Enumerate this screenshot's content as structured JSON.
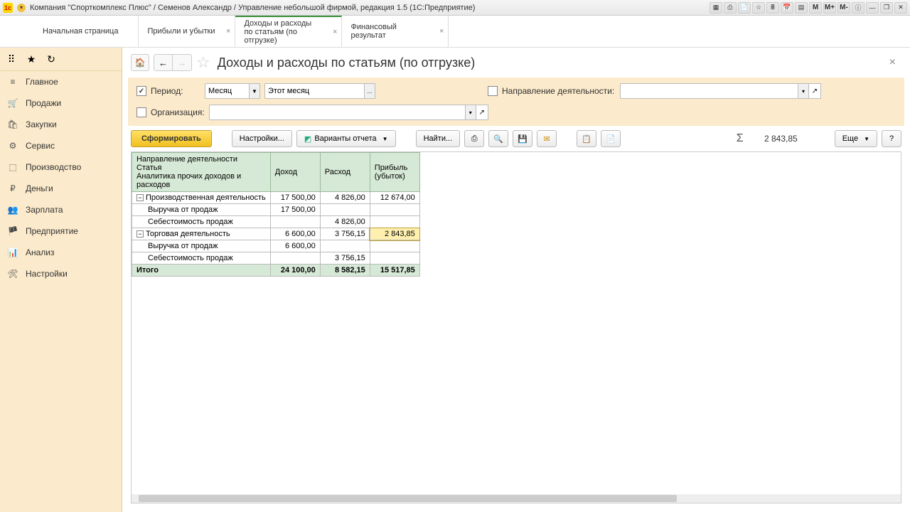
{
  "titlebar": {
    "text": "Компания \"Спорткомплекс Плюс\" / Семенов Александр / Управление небольшой фирмой, редакция 1.5  (1С:Предприятие)"
  },
  "tabs": [
    {
      "label": "Начальная страница",
      "closable": false
    },
    {
      "label": "Прибыли и убытки",
      "closable": true
    },
    {
      "label": "Доходы и расходы по статьям (по отгрузке)",
      "closable": true,
      "active": true
    },
    {
      "label": "Финансовый результат",
      "closable": true
    }
  ],
  "sidebar": {
    "items": [
      {
        "icon": "≡",
        "label": "Главное"
      },
      {
        "icon": "🛒",
        "label": "Продажи"
      },
      {
        "icon": "🛍",
        "label": "Закупки"
      },
      {
        "icon": "⚙",
        "label": "Сервис"
      },
      {
        "icon": "⬚",
        "label": "Производство"
      },
      {
        "icon": "₽",
        "label": "Деньги"
      },
      {
        "icon": "👥",
        "label": "Зарплата"
      },
      {
        "icon": "🏴",
        "label": "Предприятие"
      },
      {
        "icon": "📊",
        "label": "Анализ"
      },
      {
        "icon": "🛠",
        "label": "Настройки"
      }
    ]
  },
  "page": {
    "title": "Доходы и расходы по статьям (по отгрузке)"
  },
  "filters": {
    "period_label": "Период:",
    "period_type": "Месяц",
    "period_value": "Этот месяц",
    "activity_label": "Направление деятельности:",
    "activity_value": "",
    "org_label": "Организация:",
    "org_value": ""
  },
  "toolbar": {
    "form": "Сформировать",
    "settings": "Настройки...",
    "variants": "Варианты отчета",
    "find": "Найти...",
    "more": "Еще",
    "sum_value": "2 843,85"
  },
  "report": {
    "headers": {
      "c1a": "Направление деятельности",
      "c1b": "Статья",
      "c1c": "Аналитика прочих доходов и расходов",
      "c2": "Доход",
      "c3": "Расход",
      "c4": "Прибыль (убыток)"
    },
    "rows": [
      {
        "type": "group",
        "label": "Производственная деятельность",
        "income": "17 500,00",
        "expense": "4 826,00",
        "profit": "12 674,00"
      },
      {
        "type": "child",
        "label": "Выручка от продаж",
        "income": "17 500,00",
        "expense": "",
        "profit": ""
      },
      {
        "type": "child",
        "label": "Себестоимость продаж",
        "income": "",
        "expense": "4 826,00",
        "profit": ""
      },
      {
        "type": "group",
        "label": "Торговая деятельность",
        "income": "6 600,00",
        "expense": "3 756,15",
        "profit": "2 843,85",
        "selected": true
      },
      {
        "type": "child",
        "label": "Выручка от продаж",
        "income": "6 600,00",
        "expense": "",
        "profit": ""
      },
      {
        "type": "child",
        "label": "Себестоимость продаж",
        "income": "",
        "expense": "3 756,15",
        "profit": ""
      }
    ],
    "total": {
      "label": "Итого",
      "income": "24 100,00",
      "expense": "8 582,15",
      "profit": "15 517,85"
    }
  }
}
